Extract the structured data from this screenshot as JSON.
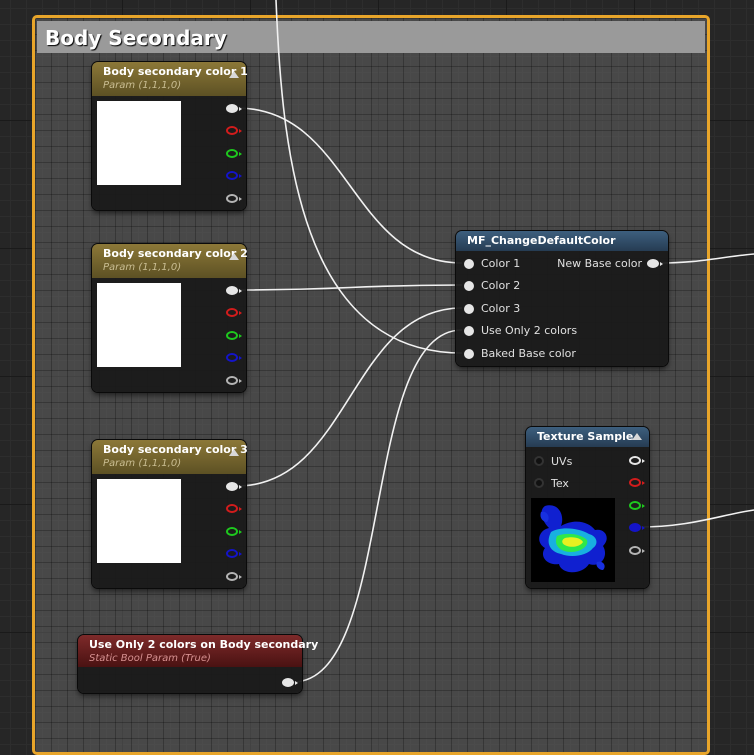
{
  "comment_box": {
    "title": "Body Secondary",
    "border_color": "#e8a52a"
  },
  "param_nodes": [
    {
      "title": "Body secondary color 1",
      "subtitle": "Param (1,1,1,0)",
      "preview_color": "#ffffff"
    },
    {
      "title": "Body secondary color 2",
      "subtitle": "Param (1,1,1,0)",
      "preview_color": "#ffffff"
    },
    {
      "title": "Body secondary color 3",
      "subtitle": "Param (1,1,1,0)",
      "preview_color": "#ffffff"
    }
  ],
  "static_bool_node": {
    "title": "Use Only 2 colors on Body secondary",
    "subtitle": "Static Bool Param (True)"
  },
  "function_node": {
    "title": "MF_ChangeDefaultColor",
    "inputs": [
      "Color 1",
      "Color 2",
      "Color 3",
      "Use Only 2 colors",
      "Baked Base color"
    ],
    "output": "New Base color"
  },
  "texture_node": {
    "title": "Texture Sample",
    "inputs": [
      "UVs",
      "Tex"
    ]
  },
  "colors": {
    "param_header": "#8c7838",
    "function_header": "#3d5f7e",
    "static_header": "#7e2a2a",
    "wire": "#f2f2f2"
  }
}
